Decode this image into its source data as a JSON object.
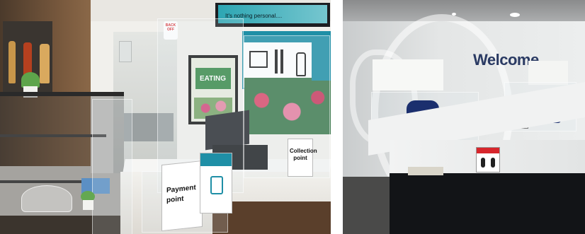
{
  "left_photo": {
    "tv_screen_text": "It's nothing personal....",
    "sticker_text": "BACK OFF",
    "poster_text": "EATING",
    "payment_sign": "Payment point",
    "collection_sign": "Collection point"
  },
  "right_photo": {
    "wall_sign": "Welcome"
  },
  "colors": {
    "accent_teal": "#1f8fa6",
    "chair_blue": "#1b2f6e",
    "sticker_red": "#d7262c"
  }
}
